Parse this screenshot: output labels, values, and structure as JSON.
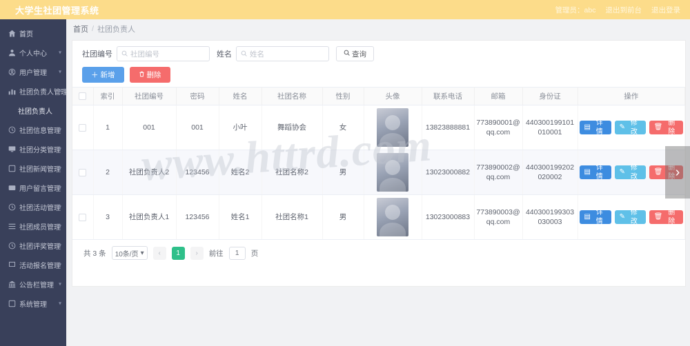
{
  "app": {
    "title": "大学生社团管理系统",
    "user_actions": [
      "管理员：abc",
      "退出到前台",
      "退出登录"
    ]
  },
  "sidebar": {
    "items": [
      {
        "label": "首页",
        "icon": "home-icon",
        "caret": false,
        "sub": false
      },
      {
        "label": "个人中心",
        "icon": "user-icon",
        "caret": true,
        "sub": false
      },
      {
        "label": "用户管理",
        "icon": "person-circle-icon",
        "caret": true,
        "sub": false
      },
      {
        "label": "社团负责人管理",
        "icon": "chart-bar-icon",
        "caret": true,
        "sub": false
      },
      {
        "label": "社团负责人",
        "icon": "",
        "caret": false,
        "sub": true
      },
      {
        "label": "社团信息管理",
        "icon": "clock-icon",
        "caret": true,
        "sub": false
      },
      {
        "label": "社团分类管理",
        "icon": "monitor-icon",
        "caret": true,
        "sub": false
      },
      {
        "label": "社团新闻管理",
        "icon": "square-icon",
        "caret": true,
        "sub": false
      },
      {
        "label": "用户留言管理",
        "icon": "message-icon",
        "caret": true,
        "sub": false
      },
      {
        "label": "社团活动管理",
        "icon": "clock-icon",
        "caret": true,
        "sub": false
      },
      {
        "label": "社团成员管理",
        "icon": "list-icon",
        "caret": true,
        "sub": false
      },
      {
        "label": "社团评奖管理",
        "icon": "clock-icon",
        "caret": true,
        "sub": false
      },
      {
        "label": "活动报名管理",
        "icon": "flag-icon",
        "caret": true,
        "sub": false
      },
      {
        "label": "公告栏管理",
        "icon": "bank-icon",
        "caret": true,
        "sub": false
      },
      {
        "label": "系统管理",
        "icon": "square-icon",
        "caret": true,
        "sub": false
      }
    ]
  },
  "breadcrumb": {
    "home": "首页",
    "sep": "/",
    "current": "社团负责人"
  },
  "search": {
    "field1_label": "社团编号",
    "field1_placeholder": "社团编号",
    "field1_value": "",
    "field2_label": "姓名",
    "field2_placeholder": "姓名",
    "field2_value": "",
    "query_button": "查询",
    "query_icon": "search-icon"
  },
  "toolbar": {
    "add_label": "新增",
    "add_icon": "plus-icon",
    "delete_label": "删除",
    "delete_icon": "trash-icon"
  },
  "table": {
    "columns": [
      "",
      "索引",
      "社团编号",
      "密码",
      "姓名",
      "社团名称",
      "性别",
      "头像",
      "联系电话",
      "邮箱",
      "身份证",
      "操作"
    ],
    "rows": [
      {
        "index": "1",
        "club_no": "001",
        "password": "001",
        "name": "小叶",
        "club_name": "舞蹈协会",
        "gender": "女",
        "avatar": "avatar-image",
        "phone": "13823888881",
        "email": "773890001@qq.com",
        "id_card": "440300199101010001"
      },
      {
        "index": "2",
        "club_no": "社团负责人2",
        "password": "123456",
        "name": "姓名2",
        "club_name": "社团名称2",
        "gender": "男",
        "avatar": "avatar-image",
        "phone": "13023000882",
        "email": "773890002@qq.com",
        "id_card": "440300199202020002"
      },
      {
        "index": "3",
        "club_no": "社团负责人1",
        "password": "123456",
        "name": "姓名1",
        "club_name": "社团名称1",
        "gender": "男",
        "avatar": "avatar-image",
        "phone": "13023000883",
        "email": "773890003@qq.com",
        "id_card": "440300199303030003"
      }
    ],
    "ops": {
      "detail_label": "详情",
      "detail_icon": "doc-icon",
      "edit_label": "修改",
      "edit_icon": "pencil-icon",
      "delete_label": "删除",
      "delete_icon": "trash-icon"
    }
  },
  "pagination": {
    "total_text": "共 3 条",
    "page_size": "10条/页",
    "prev_icon": "chevron-left-icon",
    "next_icon": "chevron-right-icon",
    "current_page": "1",
    "goto_label": "前往",
    "goto_value": "1",
    "goto_unit": "页"
  },
  "watermark": "www.httrd.com",
  "carousel": {
    "next_icon": "chevron-right-icon"
  },
  "colors": {
    "header_bg": "#fcdc8a",
    "sidebar_bg": "#39405a",
    "primary": "#5aa0ea",
    "danger": "#f56c6c",
    "edit": "#5fc0e8",
    "page_active": "#2fc08a"
  }
}
